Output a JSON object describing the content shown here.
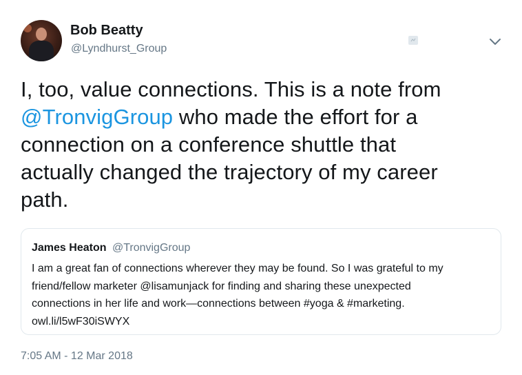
{
  "author": {
    "name": "Bob Beatty",
    "handle": "@Lyndhurst_Group"
  },
  "tweet": {
    "text_lines": [
      [
        "I, too, value connections. This is a note from",
        ""
      ],
      [
        "",
        " who made the effort for a"
      ],
      [
        "connection on a conference shuttle that",
        ""
      ],
      [
        "actually changed the trajectory of my career",
        ""
      ],
      [
        "path.",
        ""
      ]
    ],
    "line1": "I, too, value connections. This is a note from",
    "mention": "@TronvigGroup",
    "line2_rest": " who made the effort for a",
    "line3": "connection on a conference shuttle that",
    "line4": "actually changed the trajectory of my career",
    "line5": "path."
  },
  "quoted": {
    "name": "James Heaton",
    "handle": "@TronvigGroup",
    "lines": [
      "I am a great fan of connections wherever they may be found. So I was grateful to my",
      "friend/fellow marketer @lisamunjack for finding and sharing these unexpected",
      "connections in her life and work—connections between #yoga & #marketing.",
      "owl.li/l5wF30iSWYX"
    ]
  },
  "timestamp": "7:05 AM - 12 Mar 2018",
  "icons": {
    "follow": "follow-icon",
    "menu": "chevron-down-icon"
  },
  "colors": {
    "text": "#14171a",
    "secondary": "#657786",
    "link": "#1b95e0",
    "border": "#e1e8ed"
  }
}
